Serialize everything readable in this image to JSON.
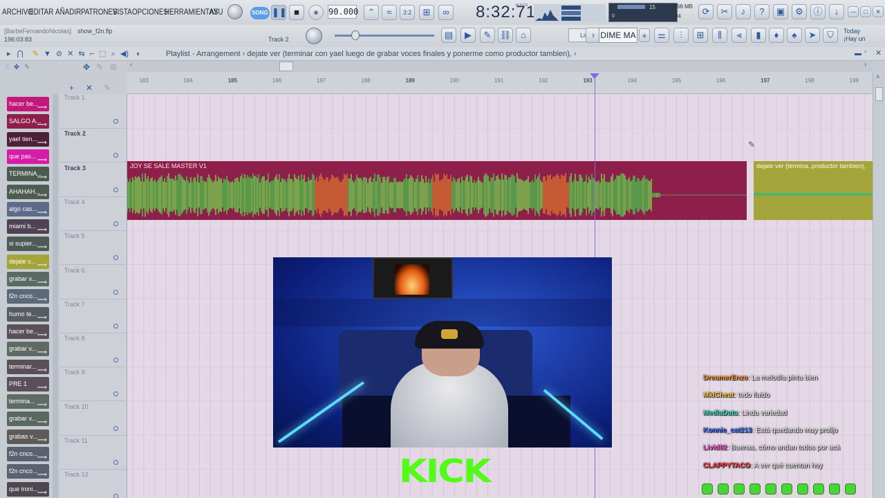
{
  "menu": [
    "ARCHIVO",
    "EDITAR",
    "AÑADIR",
    "PATRONES",
    "VISTA",
    "OPCIONES",
    "HERRAMIENTAS",
    "AYU"
  ],
  "transport": {
    "song_mode": "SONG",
    "tempo": "90.000",
    "time_display": "8:32:71",
    "time_unit": "M:S:CS"
  },
  "monitor": {
    "cpu": "15",
    "memory": "1368 MB",
    "polyphony": "94",
    "extra": "0"
  },
  "project": {
    "user": "[BarbeFernandoNicolas]",
    "file": "show_f2n.flp",
    "time": "196:03:83",
    "track_hint": "Track 2"
  },
  "snap": {
    "mode": "Linea",
    "pattern": "DIME MA"
  },
  "news": {
    "line1": "Today",
    "line2": "¡Hay un"
  },
  "playlist": {
    "title": "Playlist - Arrangement",
    "song": "dejate ver (terminar con yael luego de grabar voces finales y ponerme como productor tambien),"
  },
  "clip_list": [
    {
      "label": "hacer be...",
      "color": "#c2187a"
    },
    {
      "label": "SALGO A...",
      "color": "#8e1f4a"
    },
    {
      "label": "yael tien...",
      "color": "#4e2036"
    },
    {
      "label": "que pas...",
      "color": "#d81ba6"
    },
    {
      "label": "TERMINA...",
      "color": "#4a5a4f"
    },
    {
      "label": "AHAHAH...",
      "color": "#4e5c51"
    },
    {
      "label": "algo cas...",
      "color": "#5e6a8a"
    },
    {
      "label": "miami b...",
      "color": "#4f4254"
    },
    {
      "label": "si supier...",
      "color": "#4f5a55"
    },
    {
      "label": "dejate v...",
      "color": "#a3a43a"
    },
    {
      "label": "grabar v...",
      "color": "#5a6a64"
    },
    {
      "label": "f2n cnco...",
      "color": "#5b6a7a"
    },
    {
      "label": "humo te...",
      "color": "#575b62"
    },
    {
      "label": "hacer be...",
      "color": "#5a5058"
    },
    {
      "label": "grabar v...",
      "color": "#5f6b62"
    },
    {
      "label": "terminar...",
      "color": "#5a4f57"
    },
    {
      "label": "PRE 1",
      "color": "#5a4f5a"
    },
    {
      "label": "termina...",
      "color": "#5e6c64"
    },
    {
      "label": "grabar v...",
      "color": "#5b675f"
    },
    {
      "label": "grabas v...",
      "color": "#5d5a57"
    },
    {
      "label": "f2n cnco...",
      "color": "#5a6270"
    },
    {
      "label": "f2n cnco...",
      "color": "#5a6270"
    },
    {
      "label": "que ironi...",
      "color": "#4d4850"
    }
  ],
  "tracks": [
    "Track 1",
    "Track 2",
    "Track 3",
    "Track 4",
    "Track 5",
    "Track 6",
    "Track 7",
    "Track 8",
    "Track 9",
    "Track 10",
    "Track 11",
    "Track 12"
  ],
  "ruler": [
    "183",
    "184",
    "185",
    "186",
    "187",
    "188",
    "189",
    "190",
    "191",
    "192",
    "193",
    "194",
    "195",
    "196",
    "197",
    "198",
    "199"
  ],
  "clips": {
    "main": "JOY SE SALE MASTER V1",
    "side": "dejate ver (termina..productor tambien),"
  },
  "overlay": {
    "brand": "KICK"
  },
  "chat": [
    {
      "user": "DreamerEnzo",
      "user_color": "#ff9d3a",
      "message": "La melodía pinta bien"
    },
    {
      "user": "MkiCheat",
      "user_color": "#ffd23a",
      "message": "todo fluido"
    },
    {
      "user": "MediaData",
      "user_color": "#39e6c8",
      "message": "Linda variedad"
    },
    {
      "user": "Konnie_cat213",
      "user_color": "#3a72ff",
      "message": "Está quedando muy prolijo"
    },
    {
      "user": "Livid82",
      "user_color": "#ff6ad5",
      "message": "Buenas, cómo andan todos por acá"
    },
    {
      "user": "CLAPPYTACO",
      "user_color": "#ff3a3a",
      "message": "A ver qué cuentan hoy"
    }
  ],
  "colors": {
    "grid_bg": "#e5d8e6",
    "playhead": "#7b6fe3",
    "main_clip": "#8e1f4a",
    "side_clip": "#a3a43a",
    "kick_green": "#53fc18"
  }
}
